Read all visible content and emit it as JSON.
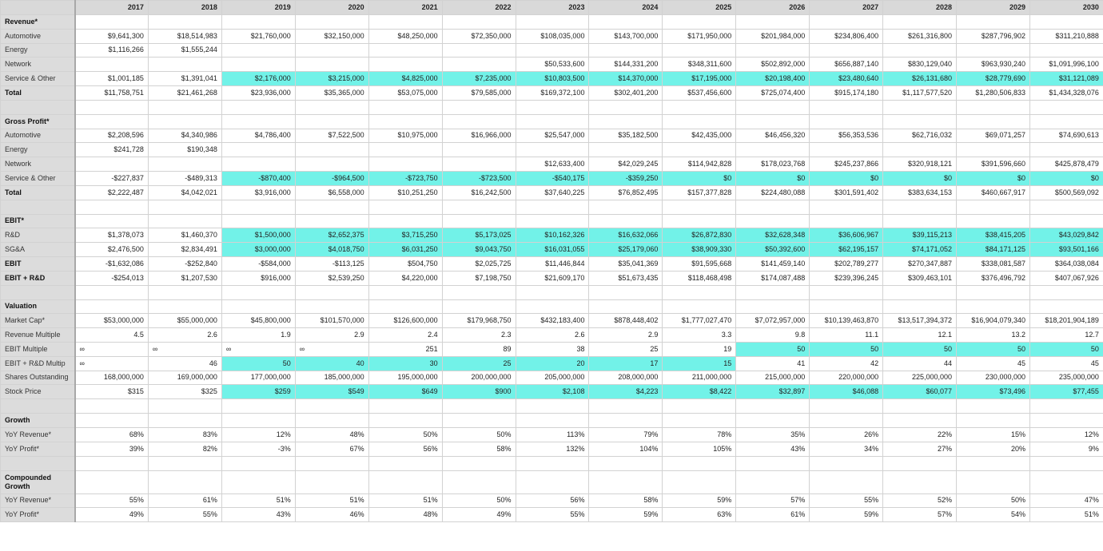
{
  "years": [
    "2017",
    "2018",
    "2019",
    "2020",
    "2021",
    "2022",
    "2023",
    "2024",
    "2025",
    "2026",
    "2027",
    "2028",
    "2029",
    "2030"
  ],
  "rows": [
    {
      "label": "Revenue*",
      "bold": true,
      "values": [
        "",
        "",
        "",
        "",
        "",
        "",
        "",
        "",
        "",
        "",
        "",
        "",
        "",
        ""
      ],
      "hl": []
    },
    {
      "label": "Automotive",
      "values": [
        "$9,641,300",
        "$18,514,983",
        "$21,760,000",
        "$32,150,000",
        "$48,250,000",
        "$72,350,000",
        "$108,035,000",
        "$143,700,000",
        "$171,950,000",
        "$201,984,000",
        "$234,806,400",
        "$261,316,800",
        "$287,796,902",
        "$311,210,888"
      ],
      "hl": []
    },
    {
      "label": "Energy",
      "values": [
        "$1,116,266",
        "$1,555,244",
        "",
        "",
        "",
        "",
        "",
        "",
        "",
        "",
        "",
        "",
        "",
        ""
      ],
      "hl": []
    },
    {
      "label": "Network",
      "values": [
        "",
        "",
        "",
        "",
        "",
        "",
        "$50,533,600",
        "$144,331,200",
        "$348,311,600",
        "$502,892,000",
        "$656,887,140",
        "$830,129,040",
        "$963,930,240",
        "$1,091,996,100"
      ],
      "hl": []
    },
    {
      "label": "Service & Other",
      "values": [
        "$1,001,185",
        "$1,391,041",
        "$2,176,000",
        "$3,215,000",
        "$4,825,000",
        "$7,235,000",
        "$10,803,500",
        "$14,370,000",
        "$17,195,000",
        "$20,198,400",
        "$23,480,640",
        "$26,131,680",
        "$28,779,690",
        "$31,121,089"
      ],
      "hl": [
        2,
        3,
        4,
        5,
        6,
        7,
        8,
        9,
        10,
        11,
        12,
        13
      ]
    },
    {
      "label": "Total",
      "bold": true,
      "values": [
        "$11,758,751",
        "$21,461,268",
        "$23,936,000",
        "$35,365,000",
        "$53,075,000",
        "$79,585,000",
        "$169,372,100",
        "$302,401,200",
        "$537,456,600",
        "$725,074,400",
        "$915,174,180",
        "$1,117,577,520",
        "$1,280,506,833",
        "$1,434,328,076"
      ],
      "hl": []
    },
    {
      "blank": true
    },
    {
      "label": "Gross Profit*",
      "bold": true,
      "values": [
        "",
        "",
        "",
        "",
        "",
        "",
        "",
        "",
        "",
        "",
        "",
        "",
        "",
        ""
      ],
      "hl": []
    },
    {
      "label": "Automotive",
      "values": [
        "$2,208,596",
        "$4,340,986",
        "$4,786,400",
        "$7,522,500",
        "$10,975,000",
        "$16,966,000",
        "$25,547,000",
        "$35,182,500",
        "$42,435,000",
        "$46,456,320",
        "$56,353,536",
        "$62,716,032",
        "$69,071,257",
        "$74,690,613"
      ],
      "hl": []
    },
    {
      "label": "Energy",
      "values": [
        "$241,728",
        "$190,348",
        "",
        "",
        "",
        "",
        "",
        "",
        "",
        "",
        "",
        "",
        "",
        ""
      ],
      "hl": []
    },
    {
      "label": "Network",
      "values": [
        "",
        "",
        "",
        "",
        "",
        "",
        "$12,633,400",
        "$42,029,245",
        "$114,942,828",
        "$178,023,768",
        "$245,237,866",
        "$320,918,121",
        "$391,596,660",
        "$425,878,479"
      ],
      "hl": []
    },
    {
      "label": "Service & Other",
      "values": [
        "-$227,837",
        "-$489,313",
        "-$870,400",
        "-$964,500",
        "-$723,750",
        "-$723,500",
        "-$540,175",
        "-$359,250",
        "$0",
        "$0",
        "$0",
        "$0",
        "$0",
        "$0"
      ],
      "hl": [
        2,
        3,
        4,
        5,
        6,
        7,
        8,
        9,
        10,
        11,
        12,
        13
      ]
    },
    {
      "label": "Total",
      "bold": true,
      "values": [
        "$2,222,487",
        "$4,042,021",
        "$3,916,000",
        "$6,558,000",
        "$10,251,250",
        "$16,242,500",
        "$37,640,225",
        "$76,852,495",
        "$157,377,828",
        "$224,480,088",
        "$301,591,402",
        "$383,634,153",
        "$460,667,917",
        "$500,569,092"
      ],
      "hl": []
    },
    {
      "blank": true
    },
    {
      "label": "EBIT*",
      "bold": true,
      "values": [
        "",
        "",
        "",
        "",
        "",
        "",
        "",
        "",
        "",
        "",
        "",
        "",
        "",
        ""
      ],
      "hl": []
    },
    {
      "label": "R&D",
      "values": [
        "$1,378,073",
        "$1,460,370",
        "$1,500,000",
        "$2,652,375",
        "$3,715,250",
        "$5,173,025",
        "$10,162,326",
        "$16,632,066",
        "$26,872,830",
        "$32,628,348",
        "$36,606,967",
        "$39,115,213",
        "$38,415,205",
        "$43,029,842"
      ],
      "hl": [
        2,
        3,
        4,
        5,
        6,
        7,
        8,
        9,
        10,
        11,
        12,
        13
      ]
    },
    {
      "label": "SG&A",
      "values": [
        "$2,476,500",
        "$2,834,491",
        "$3,000,000",
        "$4,018,750",
        "$6,031,250",
        "$9,043,750",
        "$16,031,055",
        "$25,179,060",
        "$38,909,330",
        "$50,392,600",
        "$62,195,157",
        "$74,171,052",
        "$84,171,125",
        "$93,501,166"
      ],
      "hl": [
        2,
        3,
        4,
        5,
        6,
        7,
        8,
        9,
        10,
        11,
        12,
        13
      ]
    },
    {
      "label": "EBIT",
      "bold": true,
      "values": [
        "-$1,632,086",
        "-$252,840",
        "-$584,000",
        "-$113,125",
        "$504,750",
        "$2,025,725",
        "$11,446,844",
        "$35,041,369",
        "$91,595,668",
        "$141,459,140",
        "$202,789,277",
        "$270,347,887",
        "$338,081,587",
        "$364,038,084"
      ],
      "hl": []
    },
    {
      "label": "EBIT + R&D",
      "bold": true,
      "values": [
        "-$254,013",
        "$1,207,530",
        "$916,000",
        "$2,539,250",
        "$4,220,000",
        "$7,198,750",
        "$21,609,170",
        "$51,673,435",
        "$118,468,498",
        "$174,087,488",
        "$239,396,245",
        "$309,463,101",
        "$376,496,792",
        "$407,067,926"
      ],
      "hl": []
    },
    {
      "blank": true
    },
    {
      "label": "Valuation",
      "bold": true,
      "values": [
        "",
        "",
        "",
        "",
        "",
        "",
        "",
        "",
        "",
        "",
        "",
        "",
        "",
        ""
      ],
      "hl": []
    },
    {
      "label": "Market Cap*",
      "values": [
        "$53,000,000",
        "$55,000,000",
        "$45,800,000",
        "$101,570,000",
        "$126,600,000",
        "$179,968,750",
        "$432,183,400",
        "$878,448,402",
        "$1,777,027,470",
        "$7,072,957,000",
        "$10,139,463,870",
        "$13,517,394,372",
        "$16,904,079,340",
        "$18,201,904,189"
      ],
      "hl": []
    },
    {
      "label": "Revenue Multiple",
      "values": [
        "4.5",
        "2.6",
        "1.9",
        "2.9",
        "2.4",
        "2.3",
        "2.6",
        "2.9",
        "3.3",
        "9.8",
        "11.1",
        "12.1",
        "13.2",
        "12.7"
      ],
      "hl": []
    },
    {
      "label": "EBIT Multiple",
      "values": [
        "∞",
        "∞",
        "∞",
        "∞",
        "251",
        "89",
        "38",
        "25",
        "19",
        "50",
        "50",
        "50",
        "50",
        "50"
      ],
      "hl": [
        9,
        10,
        11,
        12,
        13
      ],
      "inf": [
        0,
        1,
        2,
        3
      ]
    },
    {
      "label": "EBIT + R&D Multip",
      "values": [
        "∞",
        "46",
        "50",
        "40",
        "30",
        "25",
        "20",
        "17",
        "15",
        "41",
        "42",
        "44",
        "45",
        "45"
      ],
      "hl": [
        2,
        3,
        4,
        5,
        6,
        7,
        8
      ],
      "inf": [
        0
      ]
    },
    {
      "label": "Shares Outstanding",
      "values": [
        "168,000,000",
        "169,000,000",
        "177,000,000",
        "185,000,000",
        "195,000,000",
        "200,000,000",
        "205,000,000",
        "208,000,000",
        "211,000,000",
        "215,000,000",
        "220,000,000",
        "225,000,000",
        "230,000,000",
        "235,000,000"
      ],
      "hl": []
    },
    {
      "label": "Stock Price",
      "values": [
        "$315",
        "$325",
        "$259",
        "$549",
        "$649",
        "$900",
        "$2,108",
        "$4,223",
        "$8,422",
        "$32,897",
        "$46,088",
        "$60,077",
        "$73,496",
        "$77,455"
      ],
      "hl": [
        2,
        3,
        4,
        5,
        6,
        7,
        8,
        9,
        10,
        11,
        12,
        13
      ]
    },
    {
      "blank": true
    },
    {
      "label": "Growth",
      "bold": true,
      "values": [
        "",
        "",
        "",
        "",
        "",
        "",
        "",
        "",
        "",
        "",
        "",
        "",
        "",
        ""
      ],
      "hl": []
    },
    {
      "label": "YoY Revenue*",
      "values": [
        "68%",
        "83%",
        "12%",
        "48%",
        "50%",
        "50%",
        "113%",
        "79%",
        "78%",
        "35%",
        "26%",
        "22%",
        "15%",
        "12%"
      ],
      "hl": []
    },
    {
      "label": "YoY Profit*",
      "values": [
        "39%",
        "82%",
        "-3%",
        "67%",
        "56%",
        "58%",
        "132%",
        "104%",
        "105%",
        "43%",
        "34%",
        "27%",
        "20%",
        "9%"
      ],
      "hl": []
    },
    {
      "blank": true
    },
    {
      "label": "Compounded Growth",
      "bold": true,
      "two": true,
      "values": [
        "",
        "",
        "",
        "",
        "",
        "",
        "",
        "",
        "",
        "",
        "",
        "",
        "",
        ""
      ],
      "hl": []
    },
    {
      "label": "YoY Revenue*",
      "values": [
        "55%",
        "61%",
        "51%",
        "51%",
        "51%",
        "50%",
        "56%",
        "58%",
        "59%",
        "57%",
        "55%",
        "52%",
        "50%",
        "47%"
      ],
      "hl": []
    },
    {
      "label": "YoY Profit*",
      "values": [
        "49%",
        "55%",
        "43%",
        "46%",
        "48%",
        "49%",
        "55%",
        "59%",
        "63%",
        "61%",
        "59%",
        "57%",
        "54%",
        "51%"
      ],
      "hl": []
    }
  ]
}
